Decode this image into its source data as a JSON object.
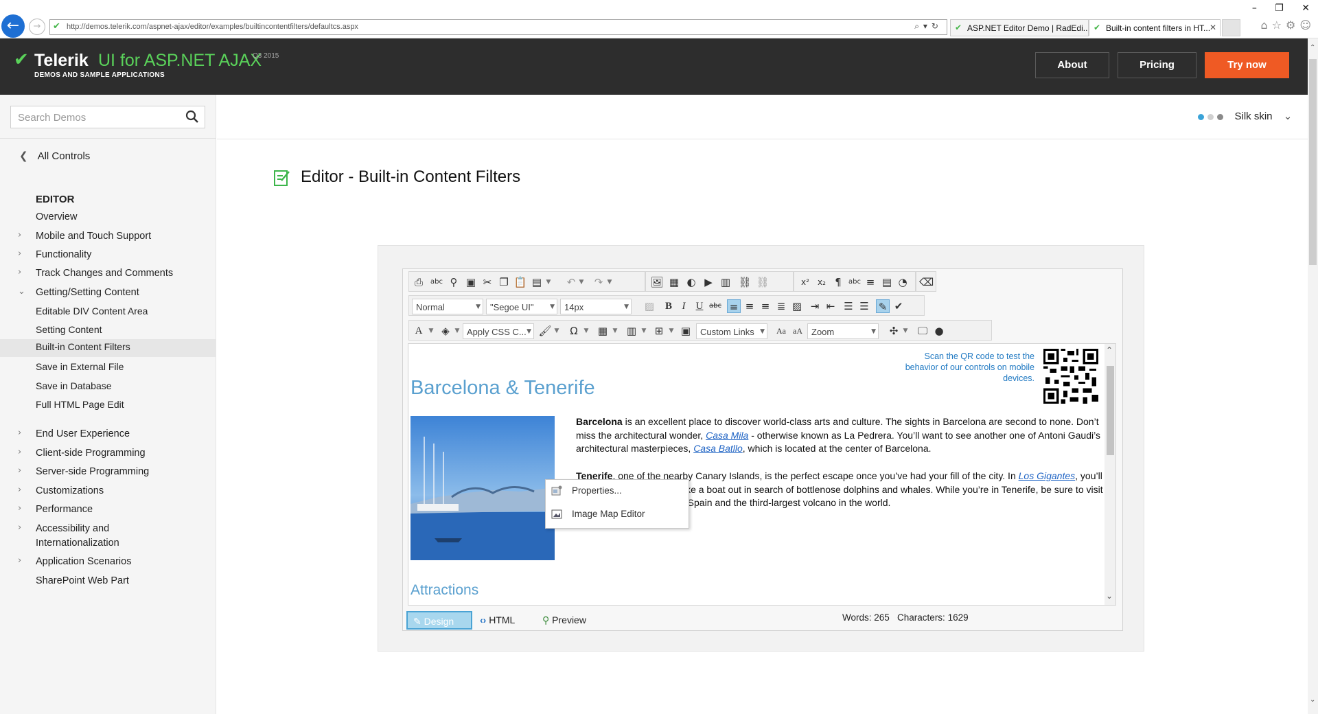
{
  "browser": {
    "url": "http://demos.telerik.com/aspnet-ajax/editor/examples/builtincontentfilters/defaultcs.aspx",
    "tabs": [
      {
        "title": "ASP.NET Editor Demo | RadEdi..."
      },
      {
        "title": "Built-in content filters in HT..."
      }
    ]
  },
  "header": {
    "brand": "Telerik",
    "product": "UI for ASP.NET AJAX",
    "version": "Q3 2015",
    "subtitle": "DEMOS AND SAMPLE APPLICATIONS",
    "buttons": {
      "about": "About",
      "pricing": "Pricing",
      "try_now": "Try now"
    },
    "accent_color": "#ef5a24"
  },
  "sidebar": {
    "search_placeholder": "Search Demos",
    "all_controls": "All Controls",
    "section": "EDITOR",
    "items": [
      {
        "label": "Overview"
      },
      {
        "label": "Mobile and Touch Support"
      },
      {
        "label": "Functionality"
      },
      {
        "label": "Track Changes and Comments"
      },
      {
        "label": "Getting/Setting Content"
      },
      {
        "label": "Editable DIV Content Area"
      },
      {
        "label": "Setting Content"
      },
      {
        "label": "Built-in Content Filters"
      },
      {
        "label": "Save in External File"
      },
      {
        "label": "Save in Database"
      },
      {
        "label": "Full HTML Page Edit"
      },
      {
        "label": "End User Experience"
      },
      {
        "label": "Client-side Programming"
      },
      {
        "label": "Server-side Programming"
      },
      {
        "label": "Customizations"
      },
      {
        "label": "Performance"
      },
      {
        "label": "Accessibility and Internationalization"
      },
      {
        "label": "Application Scenarios"
      },
      {
        "label": "SharePoint Web Part"
      }
    ]
  },
  "skin": {
    "label": "Silk skin"
  },
  "page": {
    "title": "Editor - Built-in Content Filters"
  },
  "editor": {
    "toolbar": {
      "paragraph_style": "Normal",
      "font_name": "\"Segoe UI\"",
      "font_size": "14px",
      "css_class": "Apply CSS C...",
      "custom_links": "Custom Links",
      "zoom": "Zoom"
    },
    "content": {
      "qr_text": "Scan the QR code to test the behavior of our controls on mobile devices.",
      "heading": "Barcelona & Tenerife",
      "p1_bold": "Barcelona",
      "p1_text_1": " is an excellent place to discover world-class arts and culture. The sights in Barcelona are second to none. Don’t miss the architectural wonder, ",
      "p1_link_1": "Casa Mila",
      "p1_text_2": " - otherwise known as La Pedrera. You’ll want to see another one of Antoni Gaudi’s architectural masterpieces, ",
      "p1_link_2": "Casa Batllo",
      "p1_text_3": ", which is located at the center of Barcelona.",
      "p2_bold": "Tenerife",
      "p2_text_1": ", one of the nearby Canary Islands, is the perfect escape once you’ve had your fill of the city. In ",
      "p2_link_1": "Los Gigantes",
      "p2_text_2": ", you’ll find a beautiful marina. Take a boat out in search of bottlenose dolphins and whales. While you’re in Tenerife, be sure to visit Teide, the highest point in Spain and the third-largest volcano in the world.",
      "heading_2": "Attractions"
    },
    "context_menu": [
      {
        "label": "Properties...",
        "icon": "properties-icon"
      },
      {
        "label": "Image Map Editor",
        "icon": "image-map-icon"
      }
    ],
    "modes": {
      "design": "Design",
      "html": "HTML",
      "preview": "Preview"
    },
    "stats": "Words: 265   Characters: 1629"
  }
}
